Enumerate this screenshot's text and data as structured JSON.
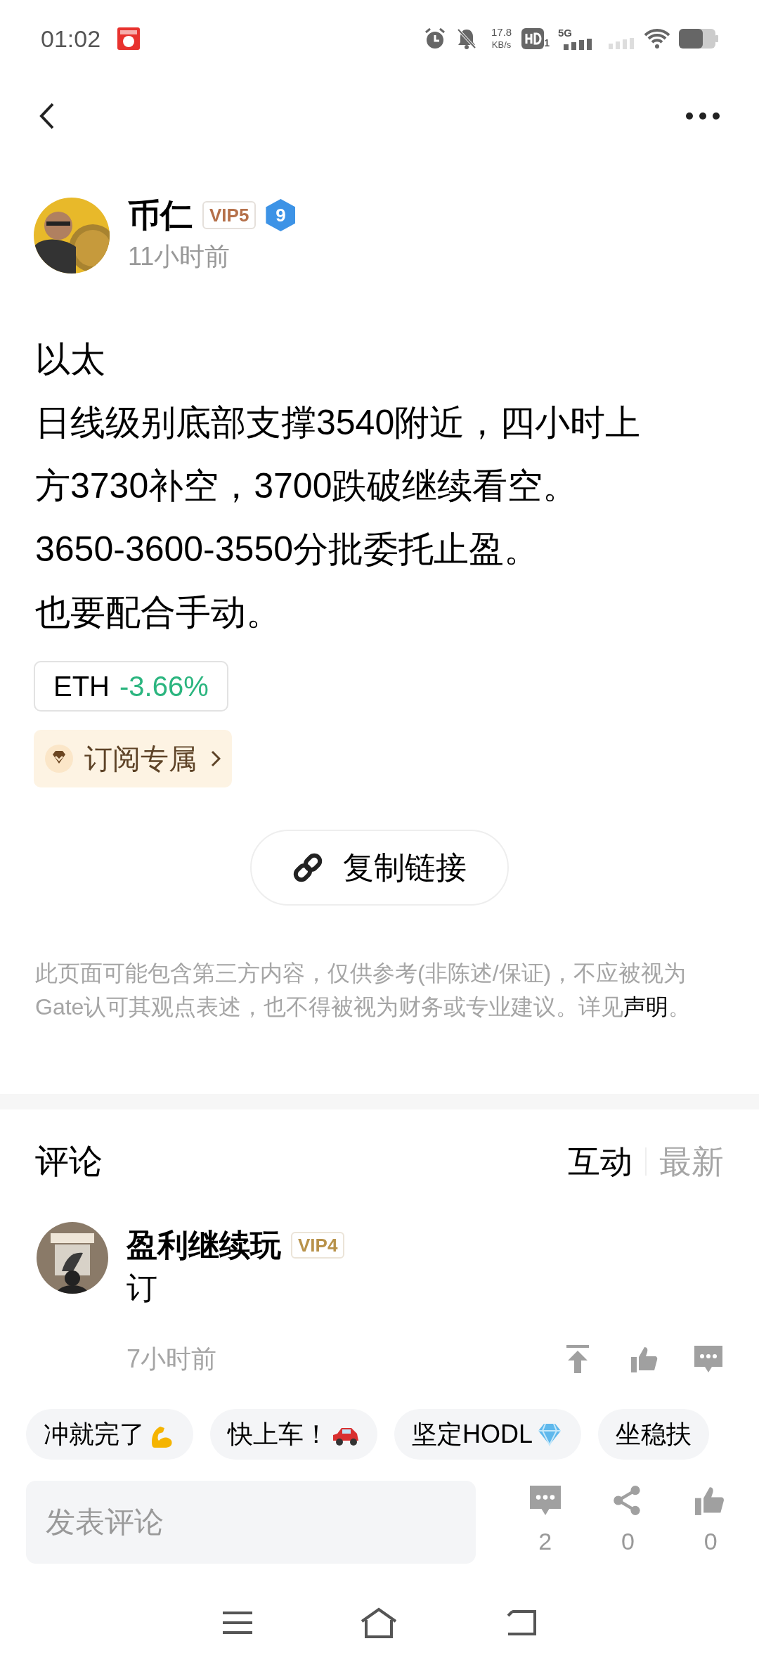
{
  "status_bar": {
    "time": "01:02",
    "net_speed_value": "17.8",
    "net_speed_unit": "KB/s",
    "hd_sub": "1",
    "network": "5G"
  },
  "author": {
    "name": "币仁",
    "vip": "VIP5",
    "level": "9",
    "time": "11小时前"
  },
  "post": {
    "paragraphs": [
      "以太",
      "日线级别底部支撑3540附近，四小时上方3730补空，3700跌破继续看空。",
      "3650-3600-3550分批委托止盈。",
      "也要配合手动。"
    ]
  },
  "ticker": {
    "symbol": "ETH",
    "change": "-3.66%",
    "falling": true
  },
  "subscribe": {
    "label": "订阅专属"
  },
  "copy_link": {
    "label": "复制链接"
  },
  "disclaimer": {
    "text": "此页面可能包含第三方内容，仅供参考(非陈述/保证)，不应被视为Gate认可其观点表述，也不得被视为财务或专业建议。详见",
    "link": "声明",
    "end": "。"
  },
  "comments": {
    "title": "评论",
    "sort_tabs": [
      {
        "label": "互动",
        "selected": true
      },
      {
        "label": "最新",
        "selected": false
      }
    ],
    "items": [
      {
        "author": "盈利继续玩",
        "vip": "VIP4",
        "text": "订",
        "time": "7小时前"
      }
    ]
  },
  "quick_replies": [
    {
      "label": "冲就完了",
      "kind": "muscle"
    },
    {
      "label": "快上车！",
      "kind": "car"
    },
    {
      "label": "坚定HODL",
      "kind": "diamond"
    },
    {
      "label": "坐稳扶",
      "kind": "plain"
    }
  ],
  "bottom_bar": {
    "placeholder": "发表评论",
    "actions": [
      {
        "kind": "comment",
        "count": "2"
      },
      {
        "kind": "share",
        "count": "0"
      },
      {
        "kind": "like",
        "count": "0"
      }
    ]
  }
}
